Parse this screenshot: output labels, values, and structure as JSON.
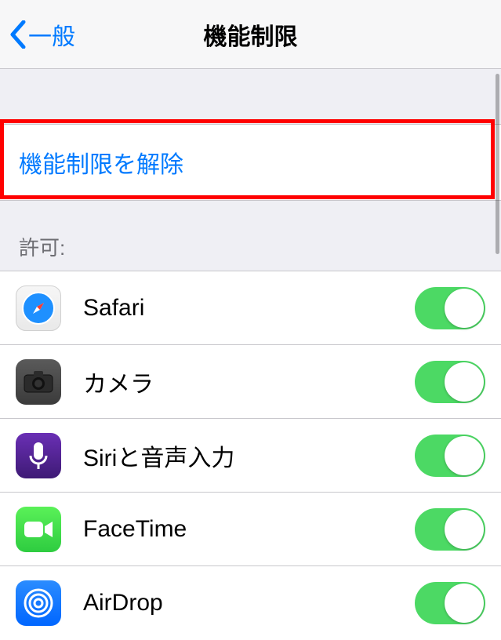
{
  "header": {
    "back_label": "一般",
    "title": "機能制限"
  },
  "action": {
    "label": "機能制限を解除"
  },
  "section": {
    "header": "許可:"
  },
  "rows": [
    {
      "icon": "safari-icon",
      "label": "Safari",
      "on": true
    },
    {
      "icon": "camera-icon",
      "label": "カメラ",
      "on": true
    },
    {
      "icon": "siri-icon",
      "label": "Siriと音声入力",
      "on": true
    },
    {
      "icon": "facetime-icon",
      "label": "FaceTime",
      "on": true
    },
    {
      "icon": "airdrop-icon",
      "label": "AirDrop",
      "on": true
    }
  ],
  "colors": {
    "link": "#007aff",
    "toggle_on": "#4cd964",
    "highlight": "#ff0000"
  }
}
